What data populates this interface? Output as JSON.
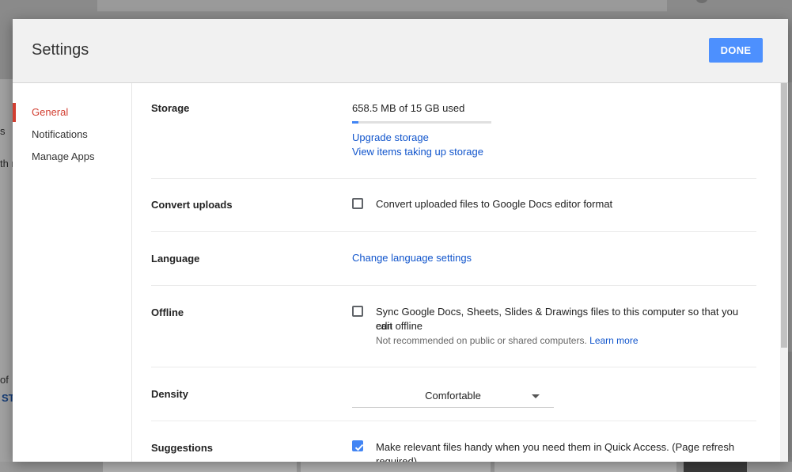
{
  "background": {
    "fragments": [
      "s",
      "th r",
      "of",
      "ST"
    ]
  },
  "dialog": {
    "title": "Settings",
    "done_label": "DONE"
  },
  "nav": {
    "items": [
      {
        "label": "General",
        "active": true
      },
      {
        "label": "Notifications",
        "active": false
      },
      {
        "label": "Manage Apps",
        "active": false
      }
    ]
  },
  "storage": {
    "label": "Storage",
    "usage_text": "658.5 MB of 15 GB used",
    "used_fraction": 0.043,
    "upgrade_link": "Upgrade storage",
    "view_items_link": "View items taking up storage"
  },
  "convert_uploads": {
    "label": "Convert uploads",
    "checked": false,
    "text": "Convert uploaded files to Google Docs editor format"
  },
  "language": {
    "label": "Language",
    "link": "Change language settings"
  },
  "offline": {
    "label": "Offline",
    "checked": false,
    "text_line1": "Sync Google Docs, Sheets, Slides & Drawings files to this computer so that you can",
    "text_line2": "edit offline",
    "hint": "Not recommended on public or shared computers.",
    "learn_more": "Learn more"
  },
  "density": {
    "label": "Density",
    "value": "Comfortable"
  },
  "suggestions": {
    "label": "Suggestions",
    "checked": true,
    "text_line1": "Make relevant files handy when you need them in Quick Access. (Page refresh",
    "text_line2": "required)"
  },
  "colors": {
    "accent": "#4285f4",
    "active_nav": "#d23f31",
    "link": "#1155cc",
    "done_button": "#4d90fe"
  }
}
